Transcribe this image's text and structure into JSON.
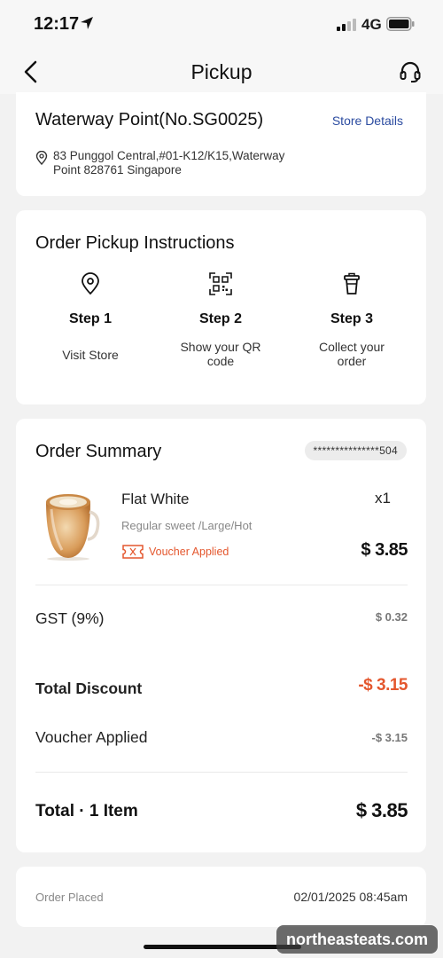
{
  "status_bar": {
    "time": "12:17",
    "network": "4G"
  },
  "header": {
    "title": "Pickup"
  },
  "store": {
    "name": "Waterway Point(No.SG0025)",
    "details_link": "Store Details",
    "address_line1": "83 Punggol Central,#01-K12/K15,Waterway",
    "address_line2": "Point 828761 Singapore"
  },
  "instructions": {
    "title": "Order Pickup Instructions",
    "steps": [
      {
        "title": "Step 1",
        "desc_line1": "Visit Store",
        "desc_line2": "",
        "icon": "location-pin-icon"
      },
      {
        "title": "Step 2",
        "desc_line1": "Show your QR",
        "desc_line2": "code",
        "icon": "qr-code-icon"
      },
      {
        "title": "Step 3",
        "desc_line1": "Collect your",
        "desc_line2": "order",
        "icon": "cup-icon"
      }
    ]
  },
  "summary": {
    "title": "Order Summary",
    "order_id": "***************504",
    "item": {
      "name": "Flat White",
      "qty": "x1",
      "options": "Regular sweet /Large/Hot",
      "voucher_label": "Voucher Applied",
      "price": "$ 3.85"
    },
    "gst_label": "GST (9%)",
    "gst_value": "$ 0.32",
    "discount_label": "Total Discount",
    "discount_value": "-$ 3.15",
    "voucher_label": "Voucher Applied",
    "voucher_value": "-$ 3.15",
    "total_label": "Total · 1 Item",
    "total_value": "$ 3.85"
  },
  "placed": {
    "label": "Order Placed",
    "value": "02/01/2025 08:45am"
  },
  "watermark": "northeasteats.com",
  "colors": {
    "accent_orange": "#e4572e",
    "link_blue": "#2b4ba0",
    "background": "#f2f2f2"
  }
}
